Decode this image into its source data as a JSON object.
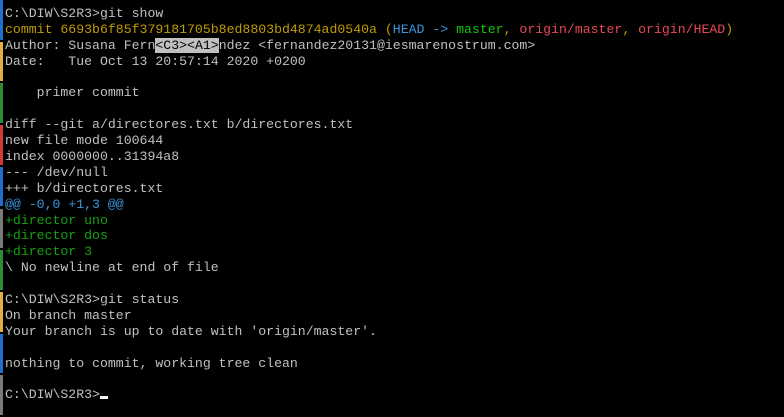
{
  "window": {
    "background": "#000000"
  },
  "colors": {
    "default": "#c0c0c0",
    "yellow": "#c19c00",
    "cyan": "#3a96dd",
    "green_bright": "#16c60c",
    "red": "#e74856",
    "green": "#13a10e",
    "cursor": "#f2f2f2"
  },
  "terminal": {
    "lines": [
      {
        "segments": [
          {
            "text": "C:\\DIW\\S2R3>git show",
            "color": "default"
          }
        ]
      },
      {
        "segments": [
          {
            "text": "commit 6693b6f85f379181705b8ed8803bd4874ad0540a ",
            "color": "yellow"
          },
          {
            "text": "(",
            "color": "yellow"
          },
          {
            "text": "HEAD -> ",
            "color": "cyan"
          },
          {
            "text": "master",
            "color": "green_bright"
          },
          {
            "text": ", ",
            "color": "yellow"
          },
          {
            "text": "origin/master",
            "color": "red"
          },
          {
            "text": ", ",
            "color": "yellow"
          },
          {
            "text": "origin/HEAD",
            "color": "red"
          },
          {
            "text": ")",
            "color": "yellow"
          }
        ]
      },
      {
        "segments": [
          {
            "text": "Author: Susana Fern",
            "color": "default"
          },
          {
            "text": "<C3>",
            "color": "default",
            "inverse": true
          },
          {
            "text": "<A1>",
            "color": "default",
            "inverse": true
          },
          {
            "text": "ndez <fernandez20131@iesmarenostrum.com>",
            "color": "default"
          }
        ]
      },
      {
        "segments": [
          {
            "text": "Date:   Tue Oct 13 20:57:14 2020 +0200",
            "color": "default"
          }
        ]
      },
      {
        "segments": [
          {
            "text": "",
            "color": "default"
          }
        ]
      },
      {
        "segments": [
          {
            "text": "    primer commit",
            "color": "default"
          }
        ]
      },
      {
        "segments": [
          {
            "text": "",
            "color": "default"
          }
        ]
      },
      {
        "segments": [
          {
            "text": "diff --git a/directores.txt b/directores.txt",
            "color": "default"
          }
        ]
      },
      {
        "segments": [
          {
            "text": "new file mode 100644",
            "color": "default"
          }
        ]
      },
      {
        "segments": [
          {
            "text": "index 0000000..31394a8",
            "color": "default"
          }
        ]
      },
      {
        "segments": [
          {
            "text": "--- /dev/null",
            "color": "default"
          }
        ]
      },
      {
        "segments": [
          {
            "text": "+++ b/directores.txt",
            "color": "default"
          }
        ]
      },
      {
        "segments": [
          {
            "text": "@@ -0,0 +1,3 @@",
            "color": "cyan"
          }
        ]
      },
      {
        "segments": [
          {
            "text": "+director uno",
            "color": "green"
          }
        ]
      },
      {
        "segments": [
          {
            "text": "+director dos",
            "color": "green"
          }
        ]
      },
      {
        "segments": [
          {
            "text": "+director 3",
            "color": "green"
          }
        ]
      },
      {
        "segments": [
          {
            "text": "\\ No newline at end of file",
            "color": "default"
          }
        ]
      },
      {
        "segments": [
          {
            "text": "",
            "color": "default"
          }
        ]
      },
      {
        "segments": [
          {
            "text": "C:\\DIW\\S2R3>git status",
            "color": "default"
          }
        ]
      },
      {
        "segments": [
          {
            "text": "On branch master",
            "color": "default"
          }
        ]
      },
      {
        "segments": [
          {
            "text": "Your branch is up to date with 'origin/master'.",
            "color": "default"
          }
        ]
      },
      {
        "segments": [
          {
            "text": "",
            "color": "default"
          }
        ]
      },
      {
        "segments": [
          {
            "text": "nothing to commit, working tree clean",
            "color": "default"
          }
        ]
      },
      {
        "segments": [
          {
            "text": "",
            "color": "default"
          }
        ]
      },
      {
        "segments": [
          {
            "text": "C:\\DIW\\S2R3>",
            "color": "default"
          }
        ],
        "cursor": true
      }
    ]
  },
  "edge_strip": [
    {
      "color": "#1f6fd1"
    },
    {
      "color": "#e0b23a"
    },
    {
      "color": "#2e8b3c"
    },
    {
      "color": "#d23a3a"
    },
    {
      "color": "#1f6fd1"
    },
    {
      "color": "#7a7a7a"
    },
    {
      "color": "#2e8b3c"
    },
    {
      "color": "#e0b23a"
    },
    {
      "color": "#1f6fd1"
    },
    {
      "color": "#7a7a7a"
    }
  ]
}
